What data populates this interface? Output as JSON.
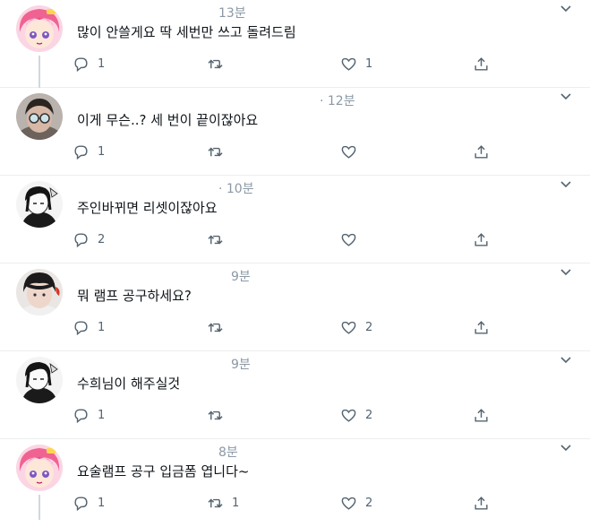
{
  "tweets": [
    {
      "time": "13분",
      "text": "많이 안쓸게요 딱 세번만 쓰고 돌려드림",
      "replies": "1",
      "retweets": "",
      "likes": "1",
      "avatar": "pink-hair-anime-avatar",
      "thread": true
    },
    {
      "time": "· 12분",
      "text": "이게 무슨..? 세 번이 끝이잖아요",
      "replies": "1",
      "retweets": "",
      "likes": "",
      "avatar": "glasses-person-avatar",
      "thread": false
    },
    {
      "time": "· 10분",
      "text": "주인바뀌면 리셋이잖아요",
      "replies": "2",
      "retweets": "",
      "likes": "",
      "avatar": "monochrome-anime-avatar",
      "thread": false
    },
    {
      "time": "9분",
      "text": "뭐 램프 공구하세요?",
      "replies": "1",
      "retweets": "",
      "likes": "2",
      "avatar": "dark-hair-person-avatar",
      "thread": false
    },
    {
      "time": "9분",
      "text": "수희님이 해주실것",
      "replies": "1",
      "retweets": "",
      "likes": "2",
      "avatar": "monochrome-anime-avatar",
      "thread": false
    },
    {
      "time": "8분",
      "text": "요술램프 공구 입금폼 엽니다~",
      "replies": "1",
      "retweets": "1",
      "likes": "2",
      "avatar": "pink-hair-anime-avatar",
      "thread": true
    }
  ],
  "colors": {
    "icon": "#536471",
    "divider": "#ebeef0",
    "thread_line": "#cfd9de",
    "time": "#8b98a5"
  }
}
